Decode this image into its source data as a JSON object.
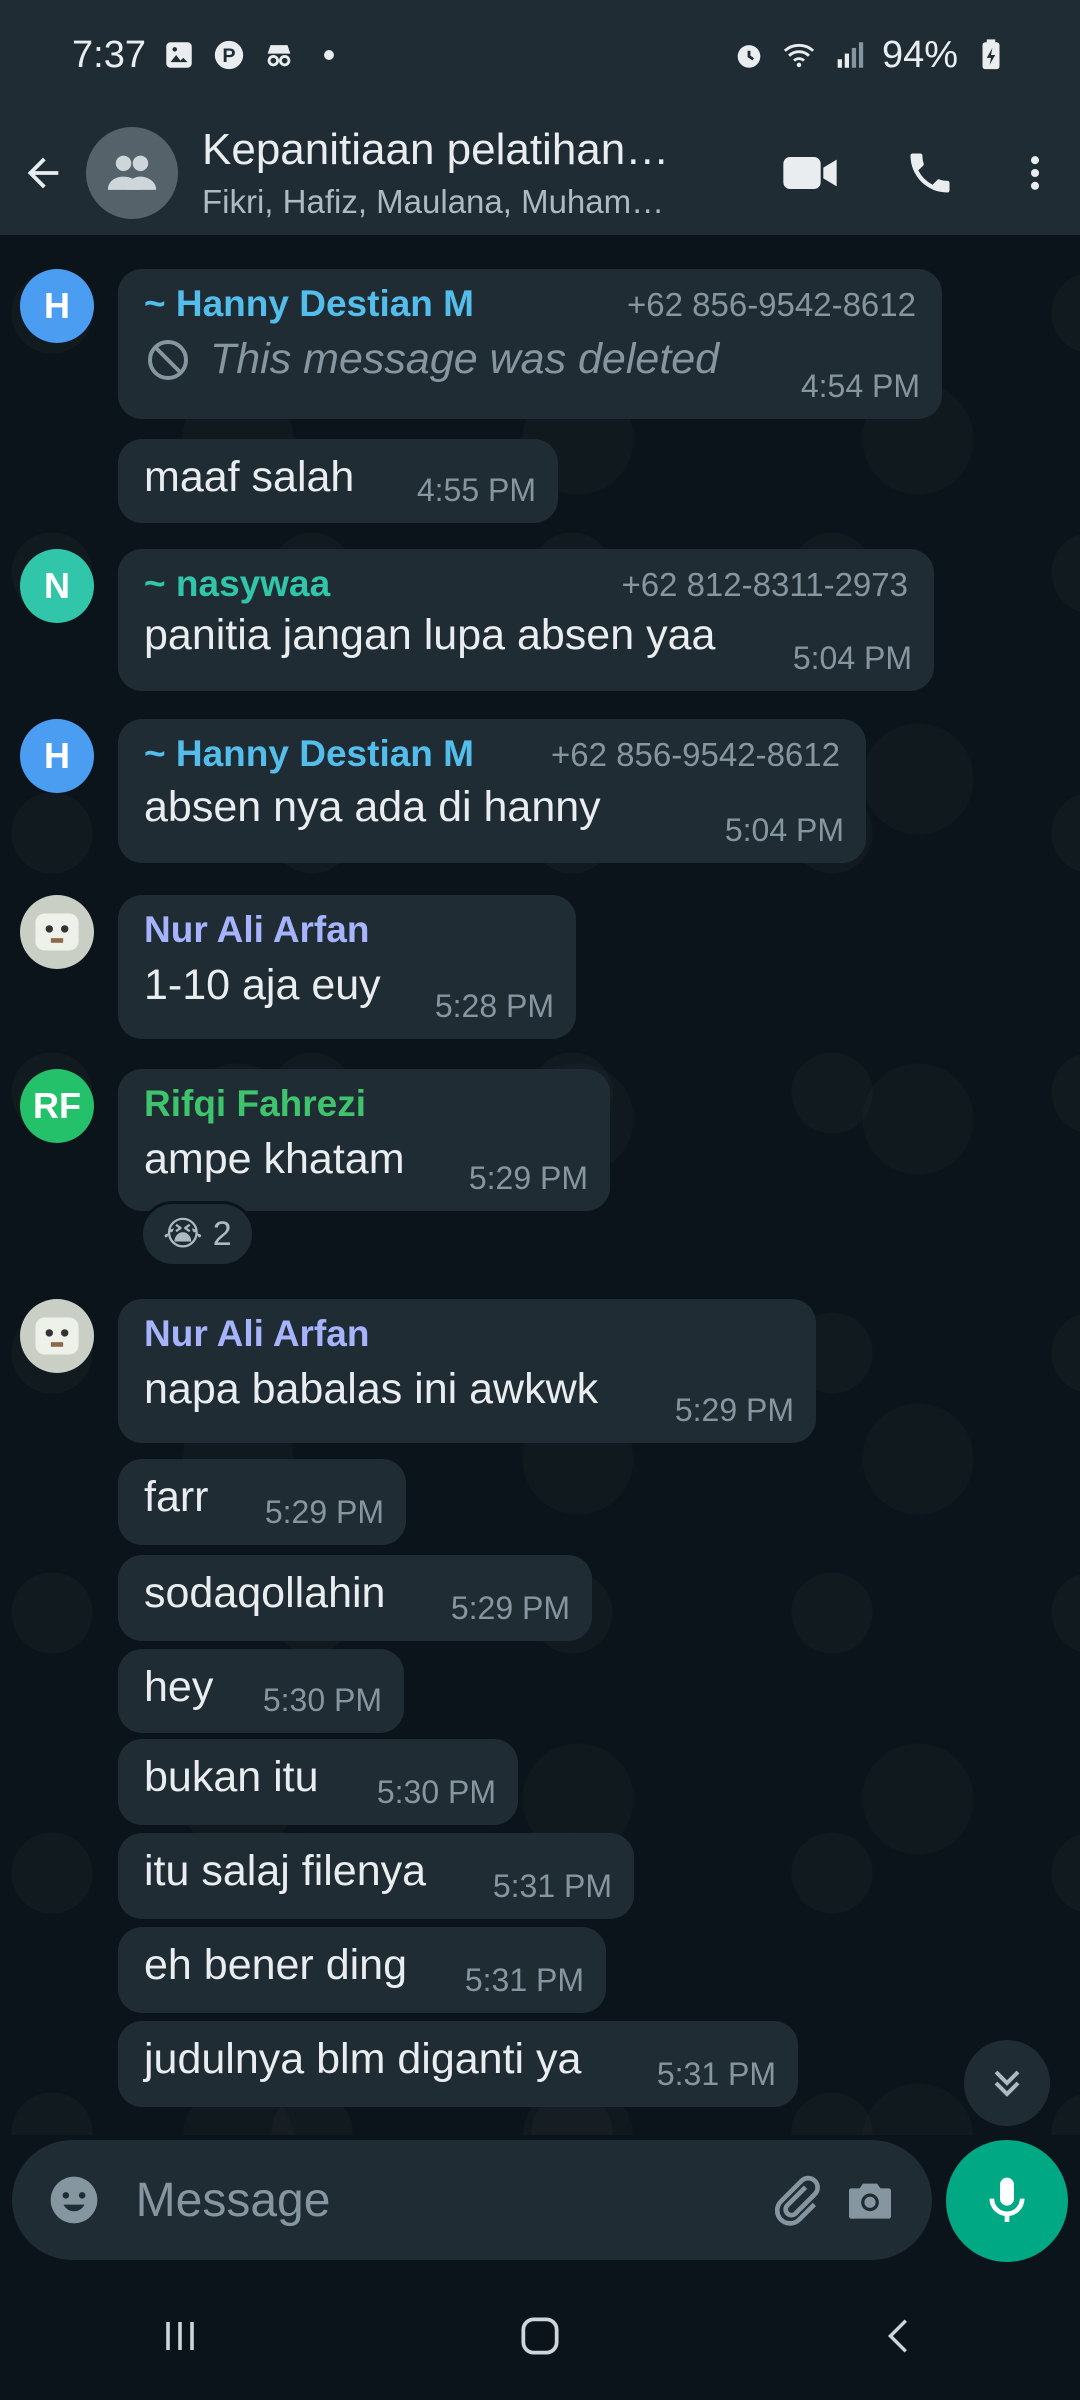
{
  "status_bar": {
    "time": "7:37",
    "battery": "94%",
    "icons_left": [
      "gallery-icon",
      "pinterest-icon",
      "incognito-icon",
      "dot-icon"
    ],
    "icons_right": [
      "alarm-icon",
      "wifi-icon",
      "signal-icon",
      "battery-charging-icon"
    ]
  },
  "header": {
    "title": "Kepanitiaan pelatihan…",
    "subtitle": "Fikri, Hafiz, Maulana, Muham…",
    "actions": [
      "video-call-icon",
      "voice-call-icon",
      "more-options-icon"
    ]
  },
  "colors": {
    "background": "#0b141a",
    "bubble": "#202c33",
    "accent": "#00a884",
    "sender_blue": "#53bdeb",
    "sender_teal": "#31c6a9",
    "sender_purple": "#a5b4fc",
    "sender_green": "#3ec46d"
  },
  "messages": [
    {
      "sender": "~ Hanny Destian M",
      "phone": "+62 856-9542-8612",
      "text": "This message was deleted",
      "time": "4:54 PM",
      "deleted": true,
      "avatar": "H"
    },
    {
      "text": "maaf salah",
      "time": "4:55 PM"
    },
    {
      "sender": "~ nasywaa",
      "phone": "+62 812-8311-2973",
      "text": "panitia jangan lupa absen yaa",
      "time": "5:04 PM",
      "avatar": "N"
    },
    {
      "sender": "~ Hanny Destian M",
      "phone": "+62 856-9542-8612",
      "text": "absen nya ada di hanny",
      "time": "5:04 PM",
      "avatar": "H"
    },
    {
      "sender": "Nur Ali Arfan",
      "text": "1-10 aja euy",
      "time": "5:28 PM"
    },
    {
      "sender": "Rifqi Fahrezi",
      "text": "ampe khatam",
      "time": "5:29 PM",
      "avatar": "RF",
      "reaction": {
        "emoji": "😭",
        "count": "2"
      }
    },
    {
      "sender": "Nur Ali Arfan",
      "text": "napa babalas ini awkwk",
      "time": "5:29 PM"
    },
    {
      "text": "farr",
      "time": "5:29 PM"
    },
    {
      "text": "sodaqollahin",
      "time": "5:29 PM"
    },
    {
      "text": "hey",
      "time": "5:30 PM"
    },
    {
      "text": "bukan itu",
      "time": "5:30 PM"
    },
    {
      "text": "itu salaj filenya",
      "time": "5:31 PM"
    },
    {
      "text": "eh bener ding",
      "time": "5:31 PM"
    },
    {
      "text": "judulnya blm diganti ya",
      "time": "5:31 PM"
    }
  ],
  "composer": {
    "placeholder": "Message"
  },
  "nav": [
    "recent-apps-icon",
    "home-icon",
    "back-nav-icon"
  ]
}
